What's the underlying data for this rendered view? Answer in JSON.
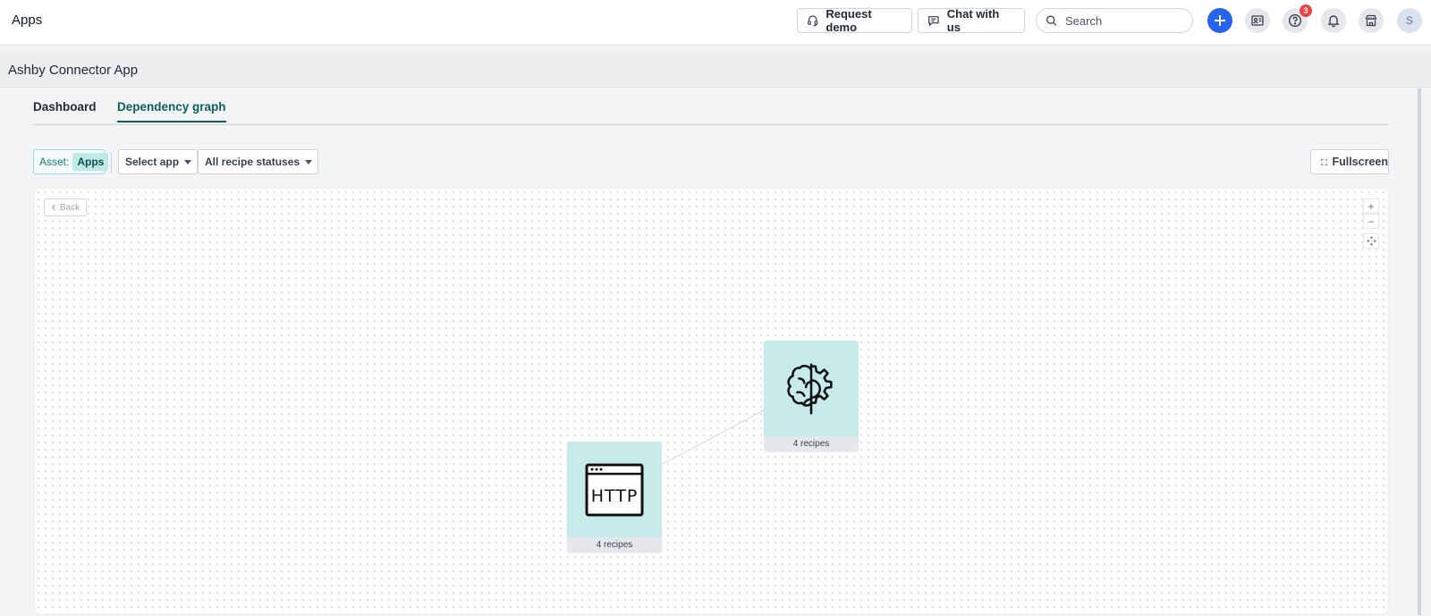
{
  "topbar": {
    "title": "Apps",
    "request_demo": "Request demo",
    "chat_with_us": "Chat with us",
    "search_placeholder": "Search",
    "help_badge": "3",
    "avatar_initial": "S"
  },
  "page": {
    "title": "Ashby Connector App"
  },
  "tabs": [
    {
      "label": "Dashboard",
      "active": false
    },
    {
      "label": "Dependency graph",
      "active": true
    }
  ],
  "filters": {
    "asset_label": "Asset:",
    "asset_value": "Apps",
    "select_app": "Select app",
    "recipe_status": "All recipe statuses",
    "fullscreen": "Fullscreen"
  },
  "graph": {
    "back_label": "Back",
    "zoom_in": "+",
    "zoom_out": "−",
    "nodes": [
      {
        "icon": "brain-gear-icon",
        "footer": "4 recipes"
      },
      {
        "icon": "http-icon",
        "footer": "4 recipes"
      }
    ]
  },
  "colors": {
    "accent": "#0d5f5b",
    "primary_button": "#2563eb",
    "node_background": "#c7eaea",
    "badge": "#ef4444"
  }
}
